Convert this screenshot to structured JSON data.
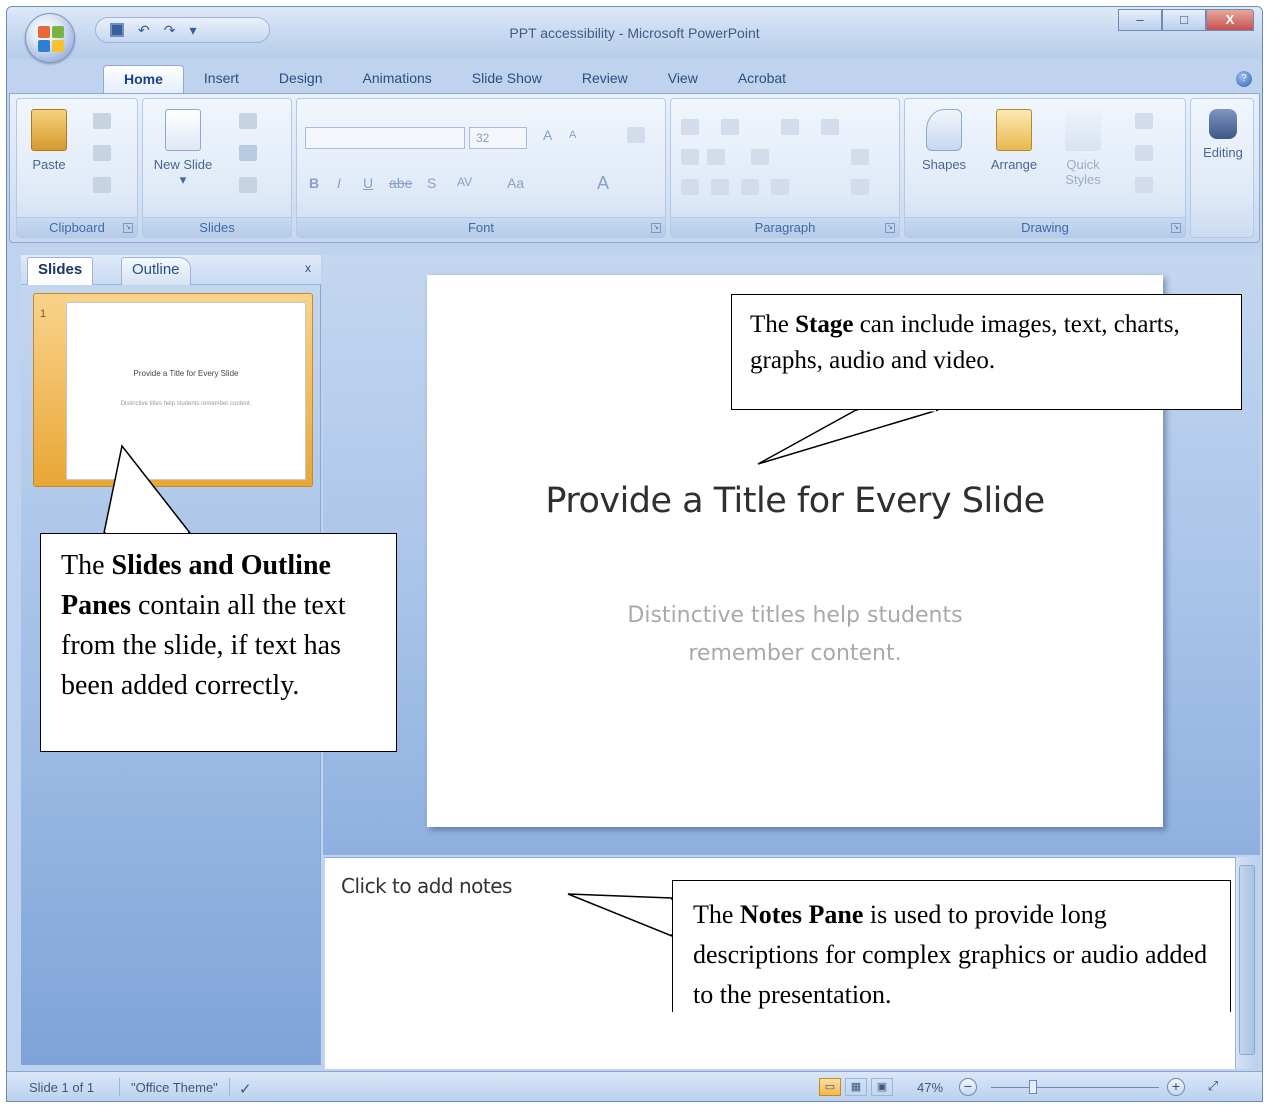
{
  "window": {
    "title": "PPT accessibility - Microsoft PowerPoint",
    "minimize": "–",
    "maximize": "□",
    "close": "X"
  },
  "quick_access": {
    "undo": "↶",
    "redo": "↷",
    "customize": "▾"
  },
  "tabs": [
    "Home",
    "Insert",
    "Design",
    "Animations",
    "Slide Show",
    "Review",
    "View",
    "Acrobat"
  ],
  "active_tab": "Home",
  "ribbon": {
    "clipboard": {
      "label": "Clipboard",
      "paste": "Paste"
    },
    "slides": {
      "label": "Slides",
      "new_slide": "New Slide ▾"
    },
    "font": {
      "label": "Font",
      "size": "32",
      "bold": "B",
      "italic": "I",
      "underline": "U",
      "strike": "abe",
      "shadow": "S",
      "spacing": "AV",
      "case": "Aa",
      "grow": "A",
      "shrink": "A",
      "color": "A"
    },
    "paragraph": {
      "label": "Paragraph"
    },
    "drawing": {
      "label": "Drawing",
      "shapes": "Shapes",
      "arrange": "Arrange",
      "quick_styles": "Quick Styles"
    },
    "editing": {
      "label": "Editing"
    }
  },
  "left_pane": {
    "tab_slides": "Slides",
    "tab_outline": "Outline",
    "close": "x",
    "thumbnail": {
      "number": "1",
      "title": "Provide a Title for Every Slide",
      "subtitle": "Distinctive titles help students remember content."
    }
  },
  "slide": {
    "title": "Provide a Title for Every Slide",
    "subtitle_line1": "Distinctive titles help students",
    "subtitle_line2": "remember content."
  },
  "notes": {
    "placeholder": "Click to add notes"
  },
  "status_bar": {
    "slide_info": "Slide 1 of 1",
    "theme": "\"Office Theme\"",
    "zoom": "47%"
  },
  "callouts": {
    "stage": {
      "pre": "The ",
      "bold": "Stage",
      "post": " can include images, text, charts, graphs, audio and video."
    },
    "slides_outline": {
      "pre": "The ",
      "bold": "Slides and Outline Panes",
      "post": " contain all the text from the slide, if  text has been added correctly."
    },
    "notes": {
      "pre": "The ",
      "bold": "Notes Pane",
      "post": " is used to provide long descriptions for complex graphics or audio added to the presentation."
    }
  },
  "colors": {
    "ribbon_blue": "#bfd3ee",
    "thumbnail_selected": "#e9a637",
    "text_blue": "#15428b"
  }
}
